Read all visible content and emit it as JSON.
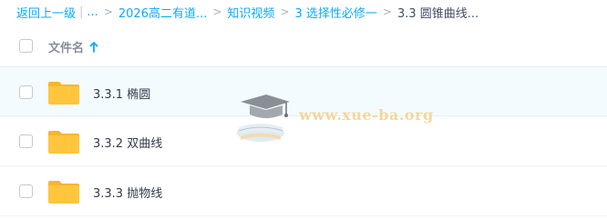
{
  "breadcrumb": {
    "back": "返回上一级",
    "ellipsis": "...",
    "items": [
      "2026高二有道...",
      "知识视频",
      "3 选择性必修一"
    ],
    "current": "3.3 圆锥曲线..."
  },
  "header": {
    "filename_label": "文件名",
    "sort_icon": "arrow-up-icon"
  },
  "files": [
    {
      "name": "3.3.1 椭圆",
      "icon": "folder-icon"
    },
    {
      "name": "3.3.2 双曲线",
      "icon": "folder-icon"
    },
    {
      "name": "3.3.3 抛物线",
      "icon": "folder-icon"
    }
  ],
  "watermark": {
    "text": "www.xue-ba.org"
  },
  "colors": {
    "link": "#09aaff",
    "folder": "#ffc53d",
    "folder_dark": "#f5b72a",
    "row_selected": "#f4fbff",
    "text": "#333b4c",
    "header_text": "#888e9a"
  }
}
